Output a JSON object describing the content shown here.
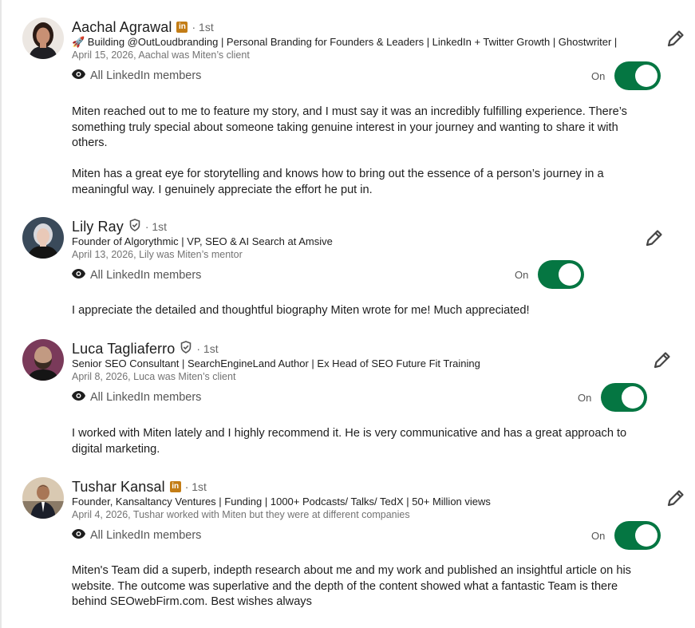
{
  "visibility_label": "All LinkedIn members",
  "toggle_label": "On",
  "recommendations": [
    {
      "name": "Aachal Agrawal",
      "badge": "linkedin-premium-icon",
      "degree": "· 1st",
      "headline": "🚀 Building @OutLoudbranding | Personal Branding for Founders &  Leaders | LinkedIn + Twitter Growth  | Ghostwriter |",
      "meta": "April 15, 2026, Aachal was Miten’s client",
      "paragraphs": [
        "Miten reached out to me to feature my story, and I must say it was an incredibly fulfilling experience. There’s something truly special about someone taking genuine interest in your journey and wanting to share it with others.",
        "Miten has a great eye for storytelling and knows how to bring out the essence of a person’s journey in a meaningful way. I genuinely appreciate the effort he put in."
      ]
    },
    {
      "name": "Lily Ray",
      "badge": "verified-icon",
      "degree": "· 1st",
      "headline": "Founder of Algorythmic | VP, SEO & AI Search at Amsive",
      "meta": "April 13, 2026, Lily was Miten’s mentor",
      "paragraphs": [
        "I appreciate the detailed and thoughtful biography Miten wrote for me! Much appreciated!"
      ]
    },
    {
      "name": "Luca Tagliaferro",
      "badge": "verified-icon",
      "degree": "· 1st",
      "headline": "Senior SEO Consultant | SearchEngineLand Author | Ex Head of SEO Future Fit Training",
      "meta": "April 8, 2026, Luca was Miten’s client",
      "paragraphs": [
        "I worked with Miten lately and I highly recommend it. He is very communicative and has a great approach to digital marketing."
      ]
    },
    {
      "name": "Tushar Kansal",
      "badge": "linkedin-premium-icon",
      "degree": "· 1st",
      "headline": "Founder, Kansaltancy Ventures | Funding | 1000+ Podcasts/ Talks/ TedX | 50+ Million views",
      "meta": "April 4, 2026, Tushar worked with Miten but they were at different companies",
      "paragraphs": [
        "Miten's Team did a superb, indepth research about me and my work and published an insightful article on his website. The outcome was superlative and the depth of the content showed what a fantastic Team is there behind SEOwebFirm.com. Best wishes always"
      ]
    }
  ]
}
